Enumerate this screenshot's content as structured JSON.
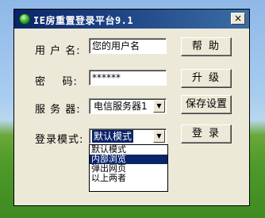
{
  "window": {
    "title": "IE房重置登录平台9.1",
    "close_glyph": "×"
  },
  "form": {
    "username_label": "用 户 名:",
    "username_value": "您的用户名",
    "password_label": "密    码:",
    "password_value": "******",
    "server_label": "服 务 器:",
    "server_value": "电信服务器1",
    "mode_label": "登录模式:",
    "mode_value": "默认模式"
  },
  "mode_options": [
    "默认模式",
    "内部浏览",
    "弹出网页",
    "以上两者"
  ],
  "mode_highlighted_index": 1,
  "buttons": {
    "help": "帮 助",
    "upgrade": "升 级",
    "save": "保存设置",
    "login": "登 录"
  }
}
